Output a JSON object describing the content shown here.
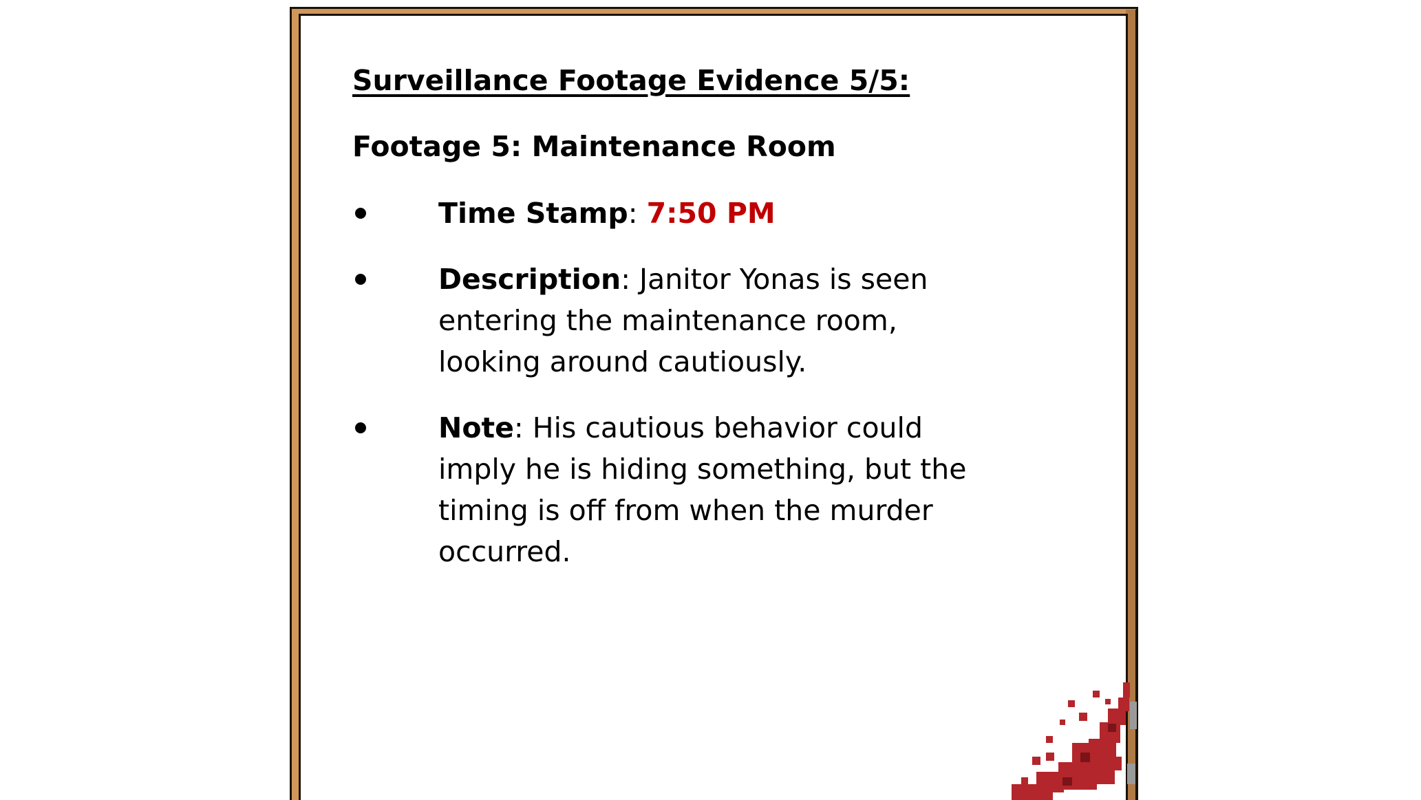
{
  "document": {
    "heading": "Surveillance Footage Evidence 5/5:",
    "subheading": "Footage 5: Maintenance Room",
    "items": [
      {
        "label": "Time Stamp",
        "separator": ": ",
        "value": "7:50 PM"
      },
      {
        "label": "Description",
        "separator": ": ",
        "value": "Janitor Yonas is seen entering the maintenance room, looking around cautiously."
      },
      {
        "label": "Note",
        "separator": ": ",
        "value": "His cautious behavior could imply he is hiding something, but the timing is off from when the murder occurred."
      }
    ]
  },
  "colors": {
    "frame": "#d1975a",
    "accent_red": "#c00000",
    "blood": "#b3262b"
  }
}
